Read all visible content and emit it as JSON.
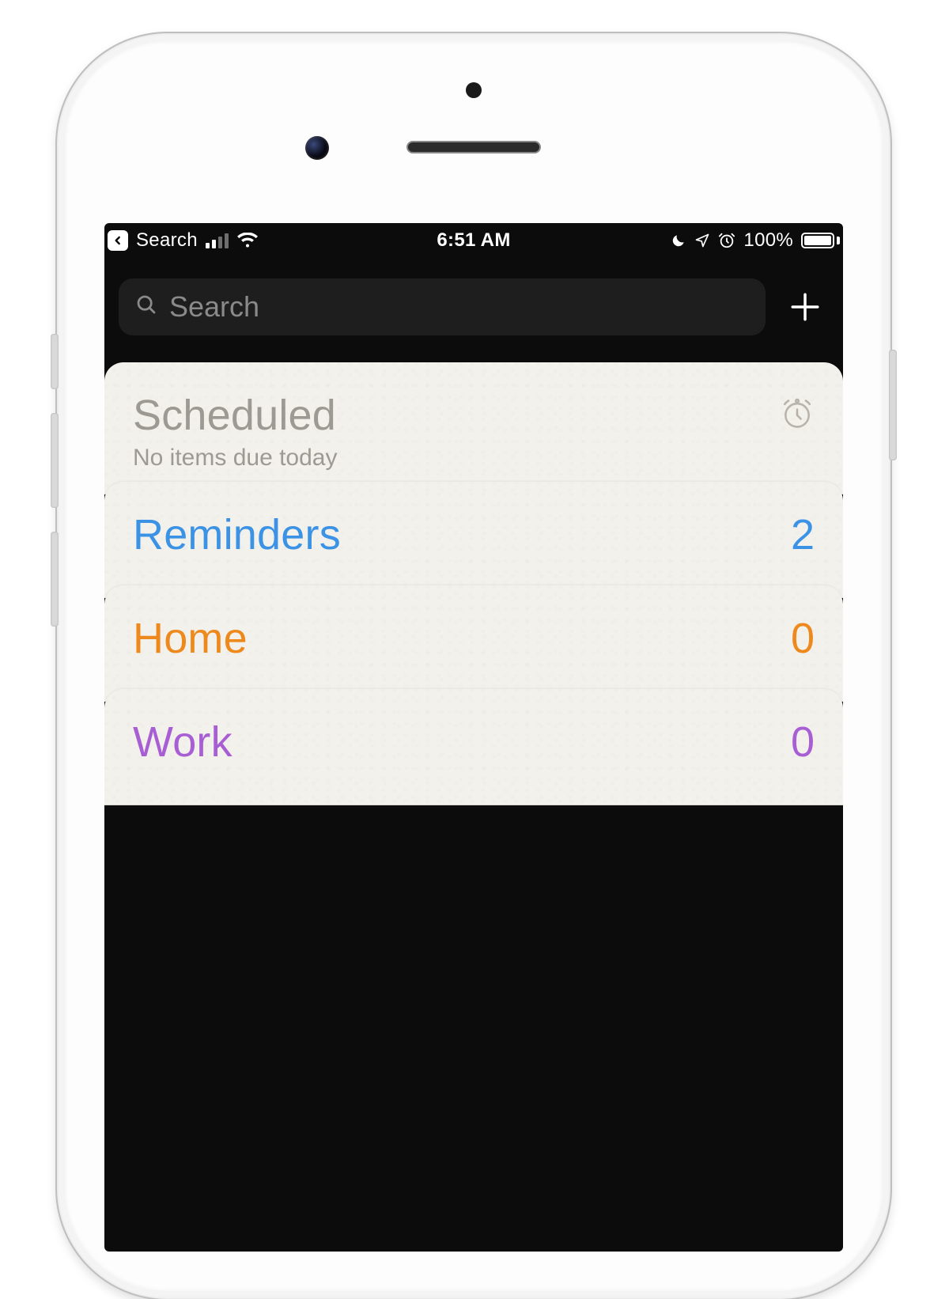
{
  "status_bar": {
    "back_label": "Search",
    "time": "6:51 AM",
    "battery_percent": "100%"
  },
  "header": {
    "search_placeholder": "Search"
  },
  "scheduled": {
    "title": "Scheduled",
    "subtitle": "No items due today"
  },
  "lists": [
    {
      "name": "Reminders",
      "count": "2",
      "color": "#3c93e6"
    },
    {
      "name": "Home",
      "count": "0",
      "color": "#ee8a1d"
    },
    {
      "name": "Work",
      "count": "0",
      "color": "#a95fd4"
    }
  ]
}
